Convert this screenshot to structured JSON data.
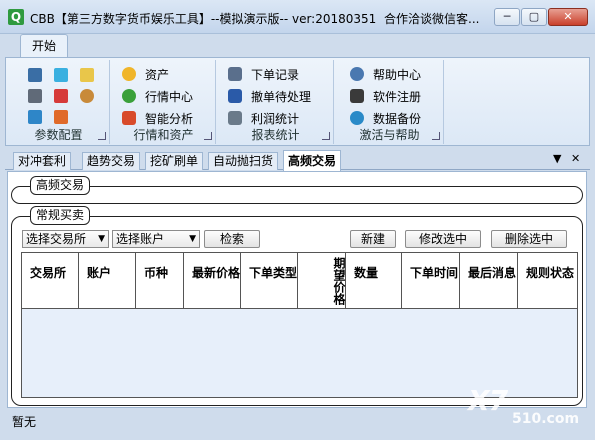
{
  "window": {
    "icon_letter": "Q",
    "title": "CBB【第三方数字货币娱乐工具】--模拟演示版-- ver:20180351",
    "title_right": "合作洽谈微信客...",
    "min_symbol": "─",
    "max_symbol": "▢",
    "close_symbol": "✕"
  },
  "ribbon": {
    "tab": "开始",
    "groups": [
      {
        "label": "参数配置"
      },
      {
        "label": "行情和资产",
        "items": [
          "资产",
          "行情中心",
          "智能分析"
        ]
      },
      {
        "label": "报表统计",
        "items": [
          "下单记录",
          "撤单待处理",
          "利润统计"
        ]
      },
      {
        "label": "激活与帮助",
        "items": [
          "帮助中心",
          "软件注册",
          "数据备份"
        ]
      }
    ]
  },
  "doc_tabs": [
    "对冲套利",
    "趋势交易",
    "挖矿刷单",
    "自动抛扫货",
    "高频交易"
  ],
  "tab_controls": {
    "menu": "▼",
    "close": "✕"
  },
  "sections": {
    "hf_title": "高频交易",
    "regular_title": "常规买卖"
  },
  "controls": {
    "exchange_select": "选择交易所",
    "account_select": "选择账户",
    "search_button": "检索",
    "new_button": "新建",
    "edit_button": "修改选中",
    "delete_button": "删除选中"
  },
  "table": {
    "columns": [
      "交易所",
      "账户",
      "币种",
      "最新价格",
      "下单类型",
      "期望价格",
      "数量",
      "下单时间",
      "最后消息",
      "规则状态"
    ]
  },
  "status": {
    "text": "暂无"
  },
  "watermark": {
    "main": "X7",
    "sub": "510.com"
  },
  "colors": {
    "accent": "#2f9a3f",
    "ribbon_bg": "#dce8f6",
    "table_bg": "#e7effa"
  }
}
